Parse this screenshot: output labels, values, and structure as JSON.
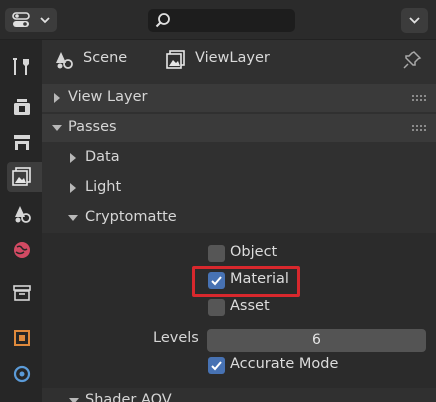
{
  "topbar": {
    "editor_type_icon": "properties-editor-icon",
    "search_placeholder": "",
    "search_value": ""
  },
  "tabs": [
    {
      "name": "tool-icon"
    },
    {
      "name": "render-icon"
    },
    {
      "name": "output-icon"
    },
    {
      "name": "view-layer-icon",
      "active": true
    },
    {
      "name": "scene-icon"
    },
    {
      "name": "world-icon"
    },
    {
      "name": "collection-icon"
    },
    {
      "name": "object-icon"
    },
    {
      "name": "modifier-icon"
    }
  ],
  "context": {
    "scene_label": "Scene",
    "view_layer_label": "ViewLayer"
  },
  "panels": {
    "view_layer": {
      "label": "View Layer",
      "expanded": false
    },
    "passes": {
      "label": "Passes",
      "expanded": true
    },
    "data": {
      "label": "Data",
      "expanded": false
    },
    "light": {
      "label": "Light",
      "expanded": false
    },
    "cryptomatte": {
      "label": "Cryptomatte",
      "expanded": true
    },
    "shader_aov": {
      "label": "Shader AOV",
      "expanded": true
    }
  },
  "cryptomatte": {
    "object": {
      "label": "Object",
      "checked": false
    },
    "material": {
      "label": "Material",
      "checked": true
    },
    "asset": {
      "label": "Asset",
      "checked": false
    },
    "levels_label": "Levels",
    "levels_value": "6",
    "accurate": {
      "label": "Accurate Mode",
      "checked": true
    }
  },
  "colors": {
    "accent": "#4772b3",
    "highlight": "#d8282d"
  }
}
